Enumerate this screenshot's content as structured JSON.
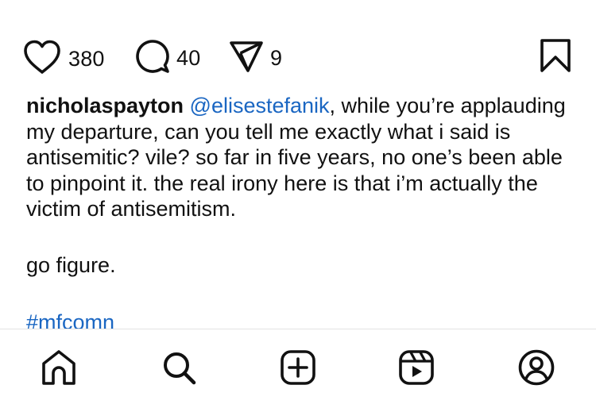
{
  "actions": {
    "likes": "380",
    "comments": "40",
    "shares": "9",
    "icons": [
      "heart-icon",
      "comment-icon",
      "send-icon",
      "bookmark-icon"
    ]
  },
  "caption": {
    "username": "nicholaspayton",
    "mention": "@elisestefanik",
    "text_line1": ", while you’re applauding my departure, can you tell me exactly what i said is antisemitic? vile? so far in five years, no one’s been able to pinpoint it. the real irony here is that i’m actually the victim of antisemitism.",
    "text_line2": "go figure.",
    "hashtag": "#mfcomn"
  },
  "tabbar": {
    "icons": [
      "home-icon",
      "search-icon",
      "create-icon",
      "reels-icon",
      "profile-icon"
    ]
  },
  "colors": {
    "link": "#1a66c2",
    "text": "#111111",
    "divider": "#e3e3e3"
  }
}
